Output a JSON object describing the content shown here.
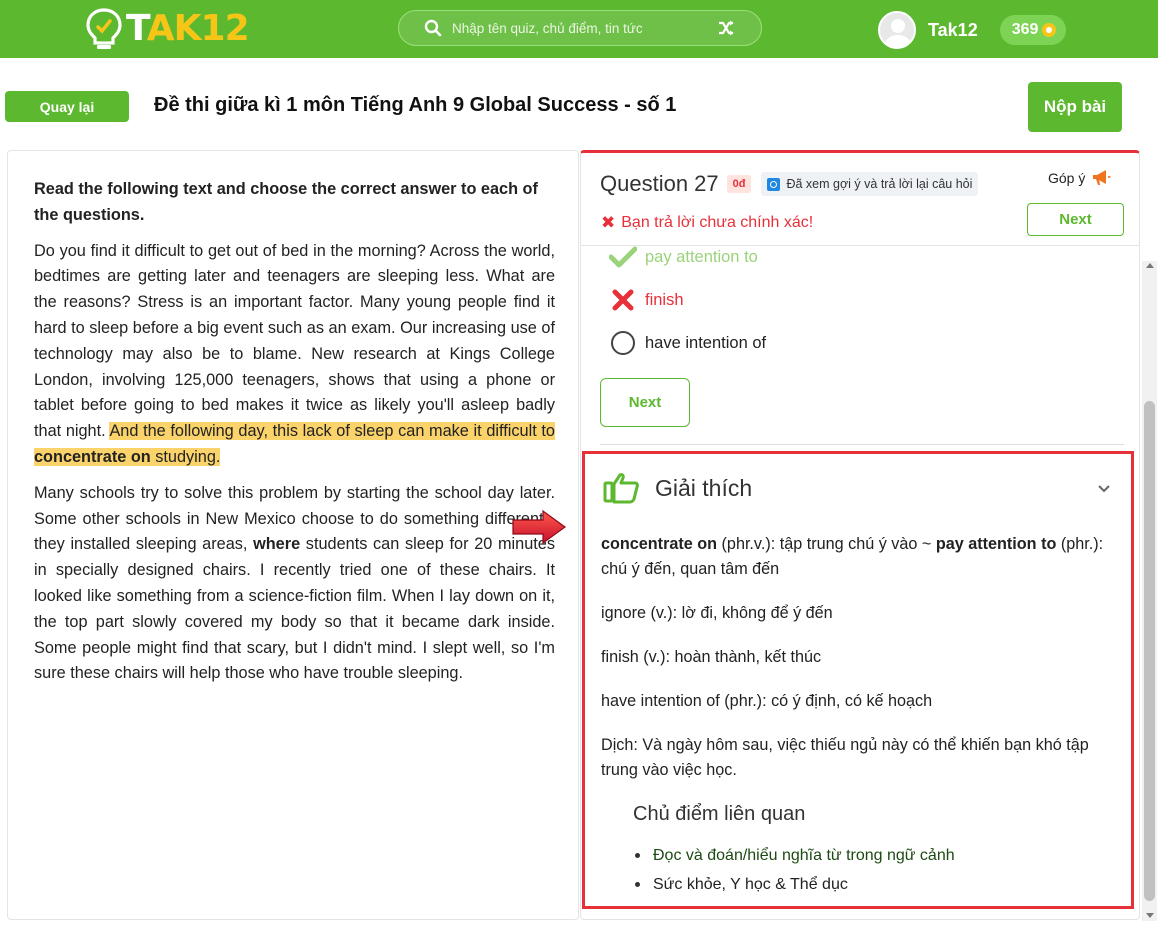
{
  "header": {
    "logo_prefix": "T",
    "logo_suffix": "AK12",
    "search_placeholder": "Nhập tên quiz, chủ điểm, tin tức",
    "username": "Tak12",
    "coins": "369"
  },
  "titlebar": {
    "back_label": "Quay lại",
    "title": "Đề thi giữa kì 1 môn Tiếng Anh 9 Global Success - số 1",
    "submit_label": "Nộp bài"
  },
  "passage": {
    "instruction": "Read the following text and choose the correct answer to each of the questions.",
    "p1_text": "Do you find it difficult to get out of bed in the morning? Across the world, bedtimes are getting later and teenagers are sleeping less. What are the reasons? Stress is an important factor. Many young people find it hard to sleep before a big event such as an exam. Our increasing use of technology may also be to blame. New research at Kings College London, involving 125,000 teenagers, shows that using a phone or tablet before going to bed makes it twice as likely you'll asleep badly that night. ",
    "p1_highlight_a": "And the following day, this lack of sleep can make it difficult to ",
    "p1_highlight_bold": "concentrate on",
    "p1_highlight_b": " studying.",
    "p2_a": "Many schools try to solve this problem by starting the school day later. Some other schools in New Mexico choose to do something different - they installed sleeping areas, ",
    "p2_bold": "where",
    "p2_b": " students can sleep for 20 minutes in specially designed chairs. I recently tried one of these chairs. It looked like something from a science-fiction film. When I lay down on it, the top part slowly covered my body so that it became dark inside. Some people might find that scary, but I didn't mind. I slept well, so I'm sure these chairs will help those who have trouble sleeping."
  },
  "question": {
    "title": "Question 27",
    "score": "0đ",
    "hint_text": "Đã xem gợi ý và trả lời lại câu hỏi",
    "feedback_label": "Góp ý",
    "wrong_msg": "Bạn trả lời chưa chính xác!",
    "next_label": "Next",
    "options": [
      {
        "label": "pay attention to",
        "state": "correct"
      },
      {
        "label": "finish",
        "state": "wrong"
      },
      {
        "label": "have intention of",
        "state": "none"
      }
    ]
  },
  "explanation": {
    "title": "Giải thích",
    "l1_bold_a": "concentrate on",
    "l1_text_a": " (phr.v.): tập trung chú ý vào ~ ",
    "l1_bold_b": "pay attention to",
    "l1_text_b": " (phr.): chú ý đến, quan tâm đến",
    "l2": "ignore (v.): lờ đi, không để ý đến",
    "l3": "finish (v.): hoàn thành, kết thúc",
    "l4": "have intention of (phr.): có ý định, có kế hoạch",
    "l5": "Dịch: Và ngày hôm sau, việc thiếu ngủ này có thể khiến bạn khó tập trung vào việc học.",
    "related_title": "Chủ điểm liên quan",
    "related": [
      "Đọc và đoán/hiểu nghĩa từ trong ngữ cảnh",
      "Sức khỏe, Y học & Thể dục"
    ]
  },
  "colors": {
    "brand_green": "#5cb82f",
    "error_red": "#e8303a",
    "highlight": "#fbd36b",
    "coin_gold": "#f5c518"
  }
}
